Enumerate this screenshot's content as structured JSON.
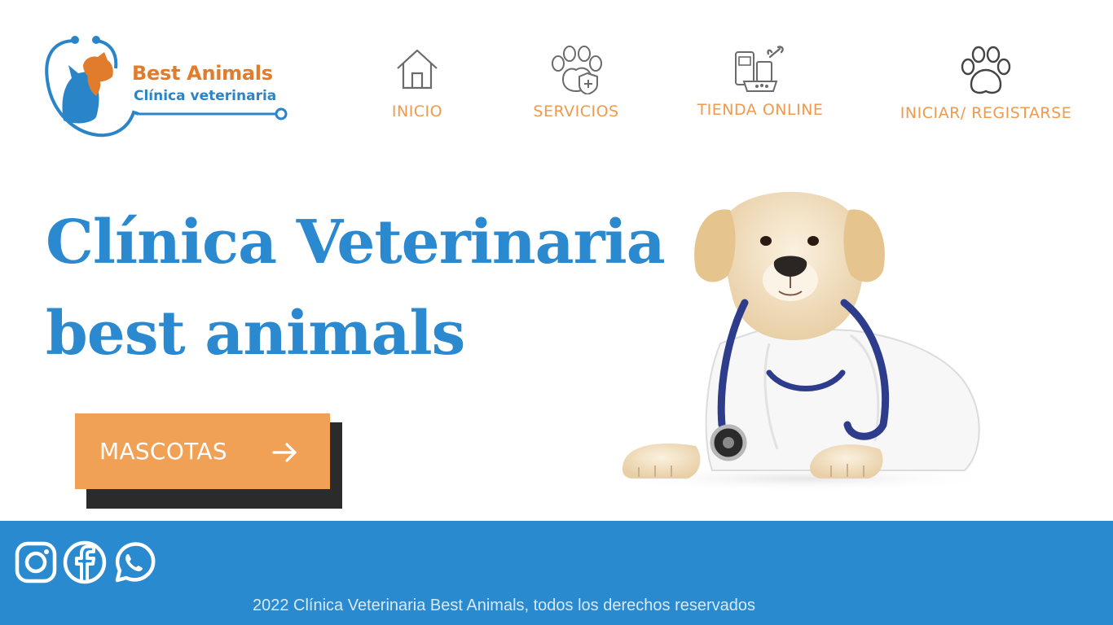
{
  "logo": {
    "title": "Best Animals",
    "subtitle": "Clínica veterinaria",
    "icon": "dog-cat-stethoscope-logo"
  },
  "nav": [
    {
      "label": "INICIO",
      "icon": "house-icon"
    },
    {
      "label": "SERVICIOS",
      "icon": "paw-shield-icon"
    },
    {
      "label": "TIENDA ONLINE",
      "icon": "pet-shop-icon"
    },
    {
      "label": "INICIAR/ REGISTARSE",
      "icon": "paw-print-icon"
    }
  ],
  "hero": {
    "title_line1": "Clínica Veterinaria",
    "title_line2": "best animals",
    "cta_label": "MASCOTAS",
    "image": "puppy-with-stethoscope"
  },
  "footer": {
    "social": [
      "instagram-icon",
      "facebook-icon",
      "whatsapp-icon"
    ],
    "copyright": "2022 Clínica Veterinaria Best Animals, todos los derechos reservados"
  },
  "colors": {
    "brand_blue": "#2a89cf",
    "accent_orange": "#ef9a4c",
    "button_orange": "#f0a156",
    "footer_blue": "#2a8ad0",
    "shadow_dark": "#2b2b2b"
  }
}
